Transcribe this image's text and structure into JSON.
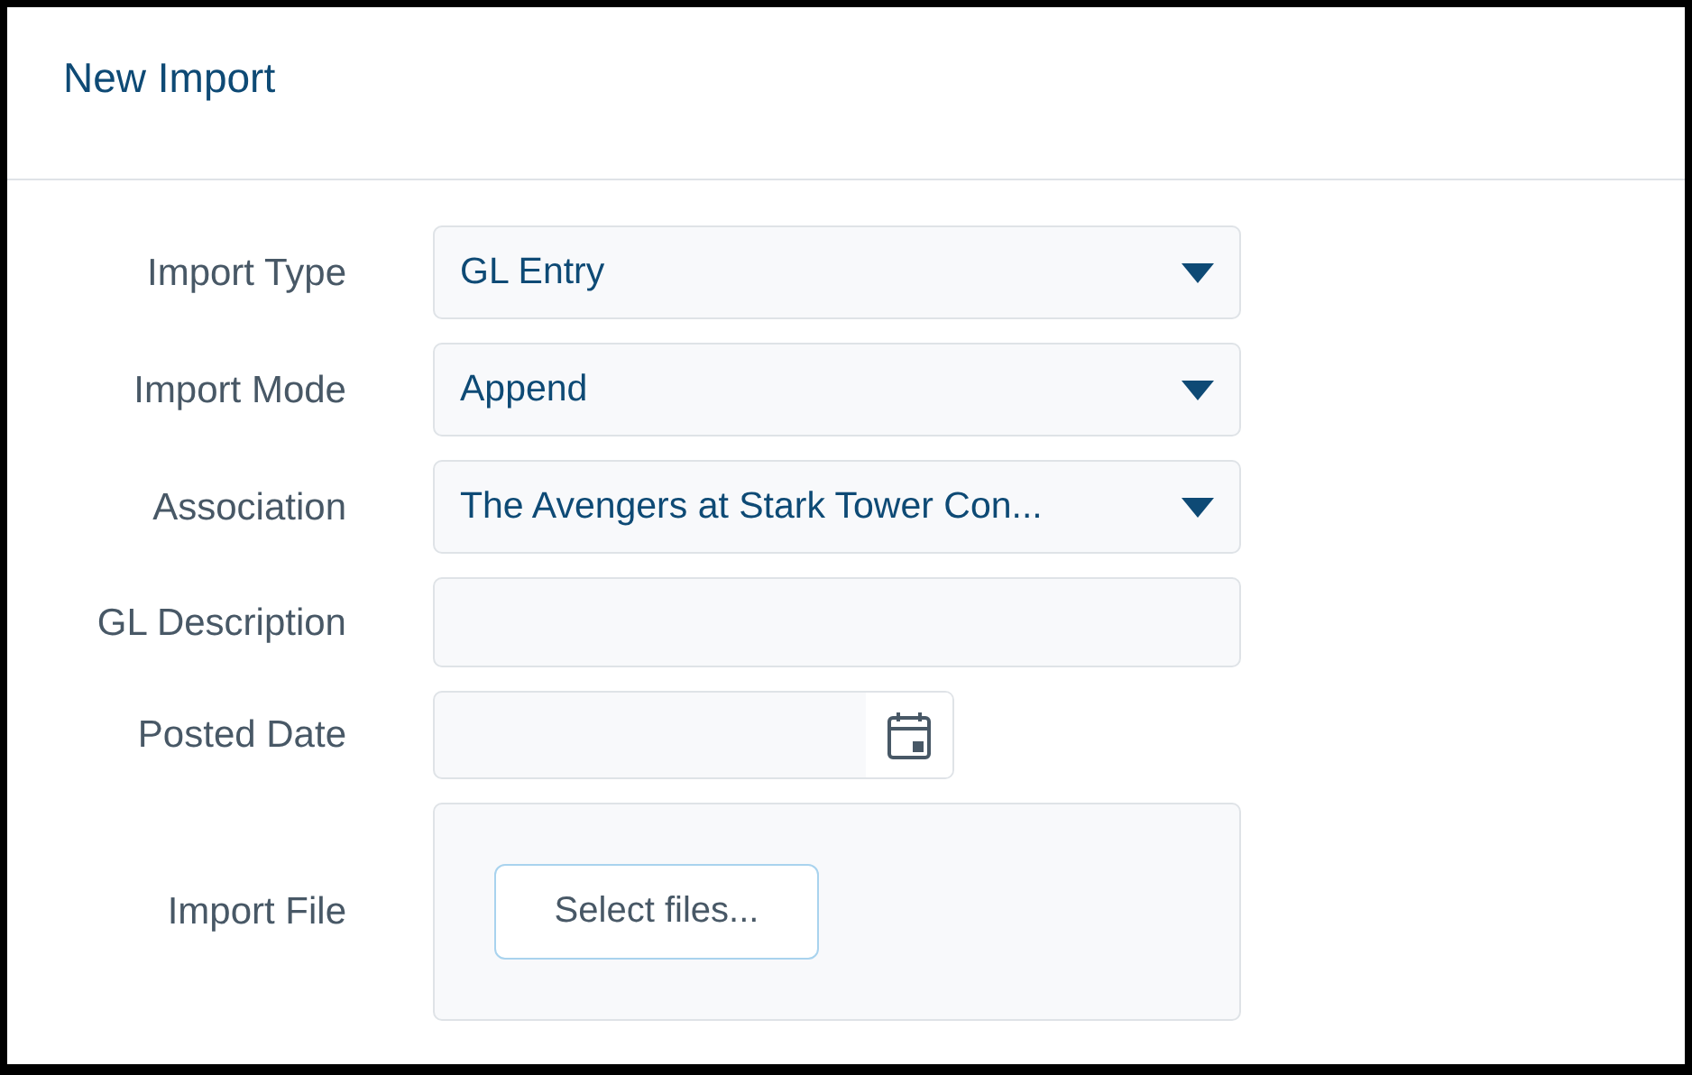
{
  "dialog": {
    "title": "New Import"
  },
  "fields": [
    {
      "label": "Import Type",
      "kind": "select",
      "value": "GL Entry"
    },
    {
      "label": "Import Mode",
      "kind": "select",
      "value": "Append"
    },
    {
      "label": "Association",
      "kind": "select",
      "value": "The Avengers at Stark Tower Con..."
    },
    {
      "label": "GL Description",
      "kind": "text"
    },
    {
      "label": "Posted Date",
      "kind": "date"
    },
    {
      "label": "Import File",
      "kind": "file",
      "button": "Select files..."
    }
  ]
}
